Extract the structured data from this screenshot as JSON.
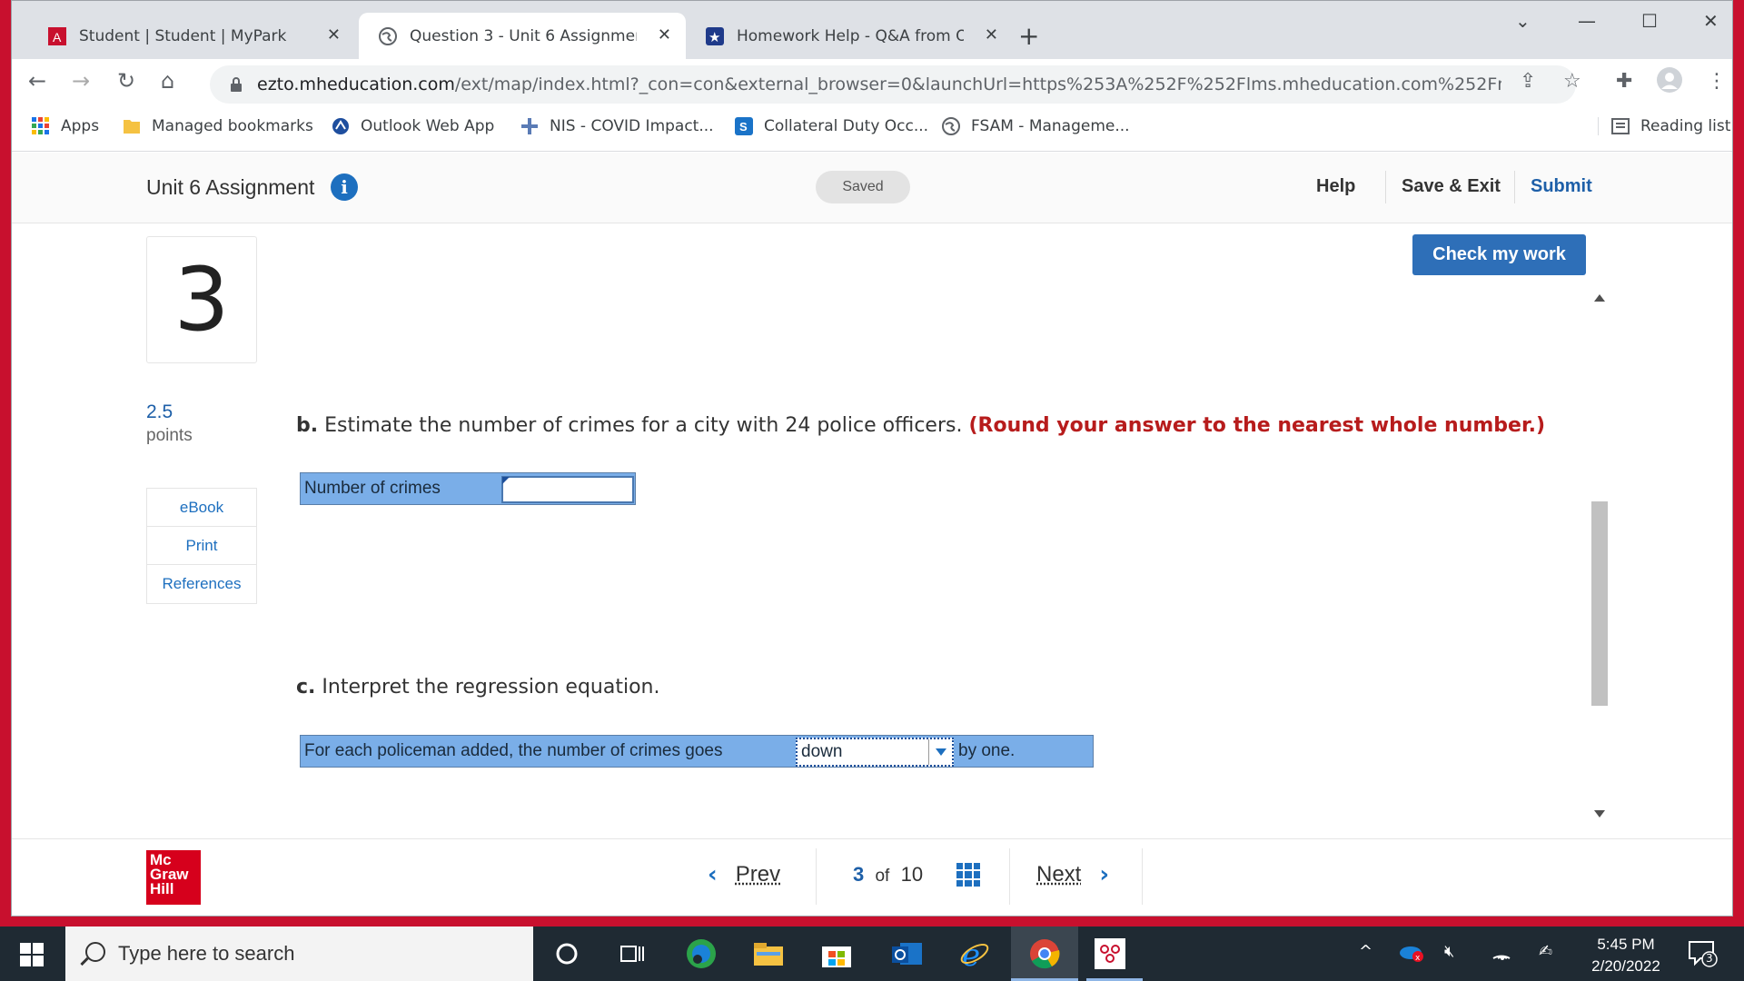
{
  "browser": {
    "tabs": [
      {
        "title": "Student | Student | MyPark",
        "active": false
      },
      {
        "title": "Question 3 - Unit 6 Assignment - ",
        "active": true
      },
      {
        "title": "Homework Help - Q&A from Onl",
        "active": false
      }
    ],
    "url_domain": "ezto.mheducation.com",
    "url_path": "/ext/map/index.html?_con=con&external_browser=0&launchUrl=https%253A%252F%252Flms.mheducation.com%252Fmg...",
    "bookmarks": [
      {
        "label": "Apps"
      },
      {
        "label": "Managed bookmarks"
      },
      {
        "label": "Outlook Web App"
      },
      {
        "label": "NIS - COVID Impact..."
      },
      {
        "label": "Collateral Duty Occ..."
      },
      {
        "label": "FSAM - Manageme..."
      }
    ],
    "reading_list": "Reading list"
  },
  "header": {
    "assignment_title": "Unit 6 Assignment",
    "saved_label": "Saved",
    "help": "Help",
    "save_exit": "Save & Exit",
    "submit": "Submit"
  },
  "question": {
    "number": "3",
    "points_value": "2.5",
    "points_label": "points",
    "side_links": [
      "eBook",
      "Print",
      "References"
    ],
    "check_button": "Check my work",
    "part_b": {
      "letter": "b.",
      "text": "Estimate the number of crimes for a city with 24 police officers.",
      "instruction": "(Round your answer to the nearest whole number.)",
      "row_label": "Number of crimes",
      "answer_value": ""
    },
    "part_c": {
      "letter": "c.",
      "text": "Interpret the regression equation.",
      "row_prefix": "For each policeman added, the number of crimes goes",
      "selected_option": "down",
      "row_suffix": "by one."
    }
  },
  "footer": {
    "logo_line1": "Mc",
    "logo_line2": "Graw",
    "logo_line3": "Hill",
    "prev": "Prev",
    "next": "Next",
    "current_page": "3",
    "of_label": "of",
    "total_pages": "10"
  },
  "taskbar": {
    "search_placeholder": "Type here to search",
    "time": "5:45 PM",
    "date": "2/20/2022",
    "notification_count": "3"
  }
}
